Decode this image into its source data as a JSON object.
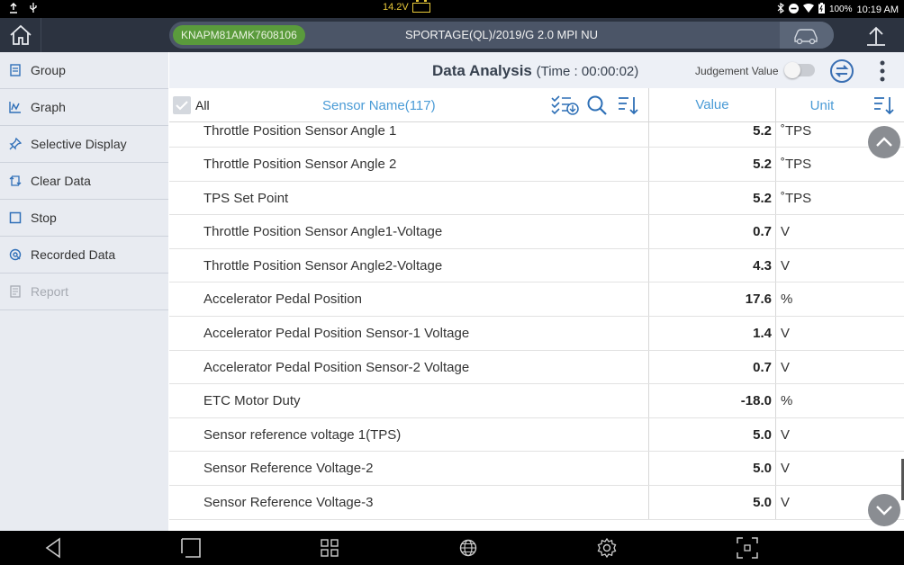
{
  "status": {
    "voltage": "14.2V",
    "battery_percent": "100%",
    "clock": "10:19 AM"
  },
  "header": {
    "vin": "KNAPM81AMK7608106",
    "vehicle": "SPORTAGE(QL)/2019/G 2.0 MPI NU"
  },
  "sidebar": {
    "items": [
      {
        "label": "Group",
        "icon": "group-icon"
      },
      {
        "label": "Graph",
        "icon": "graph-icon"
      },
      {
        "label": "Selective Display",
        "icon": "pin-icon"
      },
      {
        "label": "Clear Data",
        "icon": "clear-icon"
      },
      {
        "label": "Stop",
        "icon": "stop-icon"
      },
      {
        "label": "Recorded Data",
        "icon": "recorded-data-icon"
      },
      {
        "label": "Report",
        "icon": "report-icon"
      }
    ]
  },
  "analysis": {
    "title": "Data Analysis",
    "time": "(Time : 00:00:02)",
    "judgement_label": "Judgement Value",
    "judgement_on": false
  },
  "columns": {
    "all_label": "All",
    "sensor_name": "Sensor Name(117)",
    "value": "Value",
    "unit": "Unit"
  },
  "rows": [
    {
      "name": "Throttle Position Sensor Angle 1",
      "value": "5.2",
      "unit": "˚TPS"
    },
    {
      "name": "Throttle Position Sensor Angle 2",
      "value": "5.2",
      "unit": "˚TPS"
    },
    {
      "name": "TPS Set Point",
      "value": "5.2",
      "unit": "˚TPS"
    },
    {
      "name": "Throttle Position Sensor Angle1-Voltage",
      "value": "0.7",
      "unit": "V"
    },
    {
      "name": "Throttle Position Sensor Angle2-Voltage",
      "value": "4.3",
      "unit": "V"
    },
    {
      "name": "Accelerator Pedal Position",
      "value": "17.6",
      "unit": "%"
    },
    {
      "name": "Accelerator Pedal Position Sensor-1 Voltage",
      "value": "1.4",
      "unit": "V"
    },
    {
      "name": "Accelerator Pedal Position Sensor-2 Voltage",
      "value": "0.7",
      "unit": "V"
    },
    {
      "name": "ETC Motor Duty",
      "value": "-18.0",
      "unit": "%"
    },
    {
      "name": "Sensor reference voltage 1(TPS)",
      "value": "5.0",
      "unit": "V"
    },
    {
      "name": "Sensor Reference Voltage-2",
      "value": "5.0",
      "unit": "V"
    },
    {
      "name": "Sensor Reference Voltage-3",
      "value": "5.0",
      "unit": "V"
    }
  ]
}
